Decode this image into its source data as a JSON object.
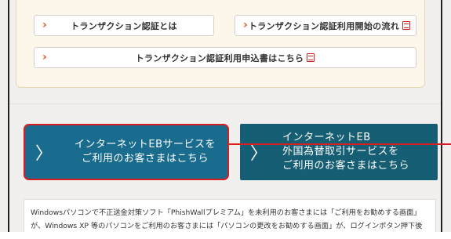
{
  "links": {
    "about": "トランザクション認証とは",
    "flow": "トランザクション認証利用開始の流れ",
    "apply": "トランザクション認証利用申込書はこちら"
  },
  "icons": {
    "chevron": "›",
    "arrow": "〉"
  },
  "buttons": {
    "eb": [
      "インターネットEBサービスを",
      "ご利用のお客さまはこちら"
    ],
    "fx": [
      "インターネットEB",
      "外国為替取引サービスを",
      "ご利用のお客さまはこちら"
    ]
  },
  "notice": {
    "text": "Windowsパソコンで不正送金対策ソフト「PhishWallプレミアム」を未利用のお客さまには「ご利用をお勧めする画面」が、Windows XP 等のパソコンをご利用のお客さまには「パソコンの更改をお勧めする画面」が、ログインボタン押下後に表示されます"
  },
  "colors": {
    "accent_orange": "#e0541b",
    "button_blue": "#1a6c8f",
    "button_teal": "#165e74",
    "highlight_red": "#d81e1e"
  }
}
